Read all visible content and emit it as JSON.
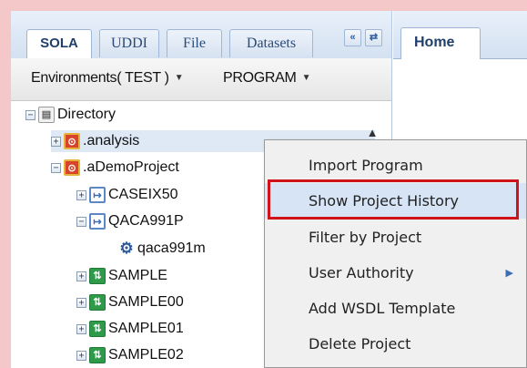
{
  "tabs": [
    "SOLA",
    "UDDI",
    "File",
    "Datasets"
  ],
  "panel_buttons": {
    "collapse": "«",
    "swap": "⇄"
  },
  "toolbar": {
    "environments": "Environments( TEST )",
    "program": "PROGRAM"
  },
  "tree": {
    "root": "Directory",
    "items": [
      {
        "label": ".analysis",
        "icon": "folder-icon"
      },
      {
        "label": ".aDemoProject",
        "icon": "folder-icon"
      },
      {
        "label": "CASEIX50",
        "icon": "program-icon"
      },
      {
        "label": "QACA991P",
        "icon": "program-icon"
      },
      {
        "label": "qaca991m",
        "icon": "gear-icon"
      },
      {
        "label": "SAMPLE",
        "icon": "package-icon"
      },
      {
        "label": "SAMPLE00",
        "icon": "package-icon"
      },
      {
        "label": "SAMPLE01",
        "icon": "package-icon"
      },
      {
        "label": "SAMPLE02",
        "icon": "package-icon"
      }
    ]
  },
  "right_tab": "Home",
  "context_menu": {
    "items": [
      "Import Program",
      "Show Project History",
      "Filter by Project",
      "User Authority",
      "Add WSDL Template",
      "Delete Project"
    ],
    "highlighted": "Show Project History"
  },
  "colors": {
    "highlight_border": "#d0121b",
    "accent": "#3b6db5"
  }
}
